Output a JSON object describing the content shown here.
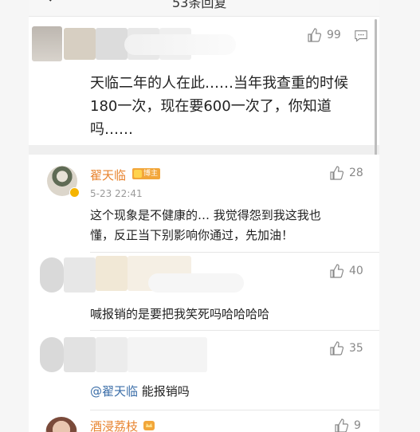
{
  "header": {
    "title": "53条回复"
  },
  "featured_comment": {
    "likes": "99",
    "text_line1": "天临二年的人在此……当年我查重的时候",
    "text_line2": "180一次，现在要600一次了，你知道",
    "text_line3": "吗……"
  },
  "comments": [
    {
      "username": "翟天临",
      "badge": "博主",
      "time": "5-23 22:41",
      "likes": "28",
      "line1": "这个现象是不健康的… 我觉得怨到我这我也",
      "line2": "懂，反正当下别影响你通过，先加油！"
    },
    {
      "likes": "40",
      "line1": "喊报销的是要把我笑死吗哈哈哈哈"
    },
    {
      "likes": "35",
      "mention": "@翟天临",
      "text": " 能报销吗"
    },
    {
      "username": "酒浸荔枝",
      "likes": "9"
    }
  ],
  "colors": {
    "accent_name": "#e8832e",
    "mention_blue": "#3b6ea8",
    "badge_orange": "#f2a63a"
  }
}
